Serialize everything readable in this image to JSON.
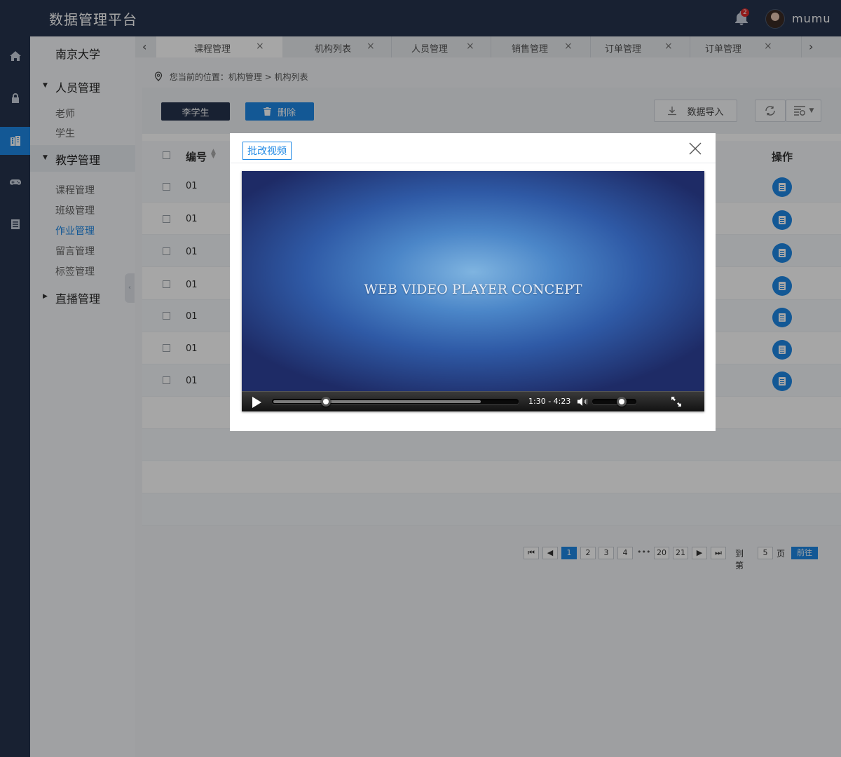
{
  "app": {
    "title": "数据管理平台",
    "notification_count": "2",
    "username": "mumu"
  },
  "rail": {
    "items": [
      "home-icon",
      "lock-icon",
      "building-icon",
      "gamepad-icon",
      "list-icon"
    ]
  },
  "sidebar": {
    "school": "南京大学",
    "groups": [
      {
        "label": "人员管理",
        "items": [
          "老师",
          "学生"
        ]
      },
      {
        "label": "教学管理",
        "items": [
          "课程管理",
          "班级管理",
          "作业管理",
          "留言管理",
          "标签管理"
        ],
        "active_item": "作业管理"
      },
      {
        "label": "直播管理",
        "items": []
      }
    ]
  },
  "tabs": [
    {
      "label": "课程管理",
      "active": true
    },
    {
      "label": "机构列表"
    },
    {
      "label": "人员管理"
    },
    {
      "label": "销售管理"
    },
    {
      "label": "订单管理"
    },
    {
      "label": "订单管理"
    }
  ],
  "breadcrumb": "您当前的位置：机构管理 > 机构列表",
  "toolbar": {
    "student_btn": "李学生",
    "delete_btn": "删除",
    "import_btn": "数据导入"
  },
  "table": {
    "headers": {
      "id": "编号",
      "action": "操作"
    },
    "rows": [
      "01",
      "01",
      "01",
      "01",
      "01",
      "01",
      "01"
    ]
  },
  "pager": {
    "pages": [
      "1",
      "2",
      "3",
      "4",
      "•••",
      "20",
      "21"
    ],
    "current": "1",
    "goto_label": "到第",
    "goto_value": "5",
    "page_unit": "页",
    "go_btn": "前往"
  },
  "modal": {
    "title": "批改视频",
    "video": {
      "caption": "WEB VIDEO PLAYER CONCEPT",
      "time": "1:30 - 4:23",
      "progress": 0.22,
      "buffered": 0.85,
      "volume": 0.67
    }
  }
}
